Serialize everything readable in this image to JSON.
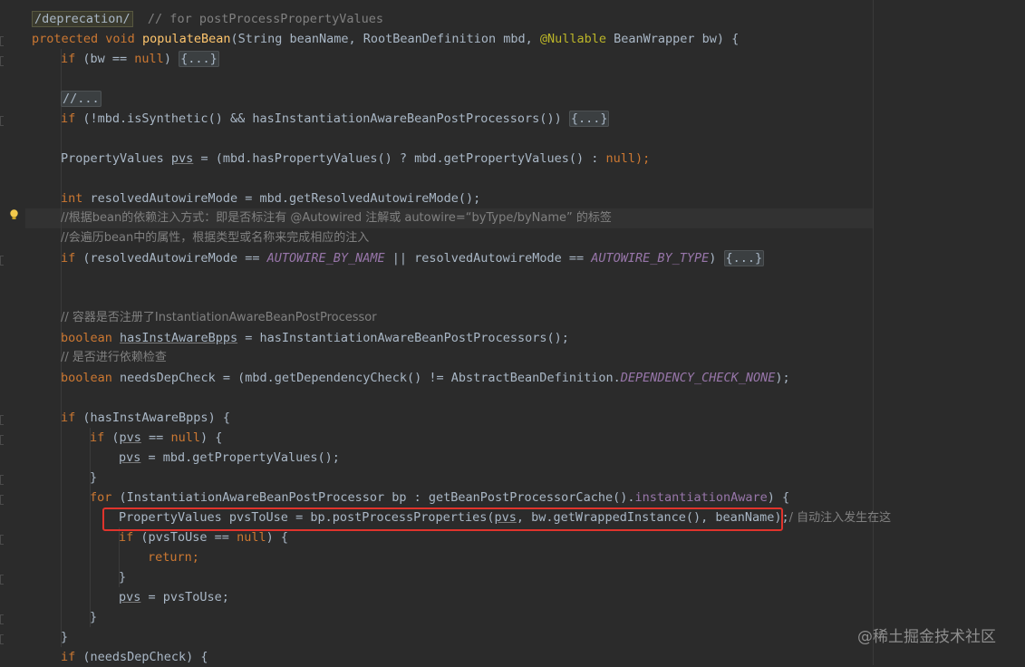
{
  "editor": {
    "lines": {
      "l0_deprecation": "/deprecation/",
      "l0_comment": "  // for postProcessPropertyValues",
      "l1_protected": "protected",
      "l1_void": " void ",
      "l1_method": "populateBean",
      "l1_params_a": "(String beanName, RootBeanDefinition mbd, ",
      "l1_nullable": "@Nullable",
      "l1_params_b": " BeanWrapper bw) {",
      "l2_if": "if",
      "l2_cond": " (bw == ",
      "l2_null": "null",
      "l2_close": ") ",
      "l2_fold": "{...}",
      "l4_comment": "//...",
      "l5_if": "if",
      "l5_cond": " (!mbd.isSynthetic() && hasInstantiationAwareBeanPostProcessors()) ",
      "l5_fold": "{...}",
      "l7_type": "PropertyValues ",
      "l7_var": "pvs",
      "l7_rest": " = (mbd.hasPropertyValues() ? mbd.getPropertyValues() : ",
      "l7_null": "null",
      "l7_end": ");",
      "l9_int": "int",
      "l9_rest": " resolvedAutowireMode = mbd.getResolvedAutowireMode();",
      "l10_comment": "//根据bean的依赖注入方式：即是否标注有 @Autowired 注解或 autowire=“byType/byName” 的标签",
      "l11_comment": "//会遍历bean中的属性，根据类型或名称来完成相应的注入",
      "l12_if": "if",
      "l12_a": " (resolvedAutowireMode == ",
      "l12_const1": "AUTOWIRE_BY_NAME",
      "l12_b": " || resolvedAutowireMode == ",
      "l12_const2": "AUTOWIRE_BY_TYPE",
      "l12_c": ") ",
      "l12_fold": "{...}",
      "l15_comment": "// 容器是否注册了InstantiationAwareBeanPostProcessor",
      "l16_bool": "boolean",
      "l16_a": " ",
      "l16_var": "hasInstAwareBpps",
      "l16_b": " = hasInstantiationAwareBeanPostProcessors();",
      "l17_comment": "// 是否进行依赖检查",
      "l18_bool": "boolean",
      "l18_a": " needsDepCheck = (mbd.getDependencyCheck() != AbstractBeanDefinition.",
      "l18_const": "DEPENDENCY_CHECK_NONE",
      "l18_b": ");",
      "l20_if": "if",
      "l20_rest": " (hasInstAwareBpps) {",
      "l21_if": "if",
      "l21_a": " (",
      "l21_var": "pvs",
      "l21_b": " == ",
      "l21_null": "null",
      "l21_c": ") {",
      "l22_var": "pvs",
      "l22_rest": " = mbd.getPropertyValues();",
      "l23_brace": "}",
      "l24_for": "for",
      "l24_a": " (InstantiationAwareBeanPostProcessor bp : getBeanPostProcessorCache().",
      "l24_field": "instantiationAware",
      "l24_b": ") {",
      "l25_a": "PropertyValues pvsToUse = bp.postProcessProperties(",
      "l25_var": "pvs",
      "l25_b": ", bw.getWrappedInstance(), beanName);",
      "l25_comment": "/ 自动注入发生在这",
      "l26_if": "if",
      "l26_a": " (pvsToUse == ",
      "l26_null": "null",
      "l26_b": ") {",
      "l27_return": "return",
      "l27_semi": ";",
      "l28_brace": "}",
      "l29_var": "pvs",
      "l29_rest": " = pvsToUse;",
      "l30_brace": "}",
      "l31_brace": "}",
      "l32_if": "if",
      "l32_rest": " (needsDepCheck) {"
    }
  },
  "watermark": "@稀土掘金技术社区",
  "theme": {
    "background": "#2b2b2b",
    "keyword": "#cc7832",
    "method": "#ffc66d",
    "comment": "#808080",
    "annotation": "#bbb529",
    "constant": "#9876aa",
    "highlight_box": "#e0342c"
  }
}
